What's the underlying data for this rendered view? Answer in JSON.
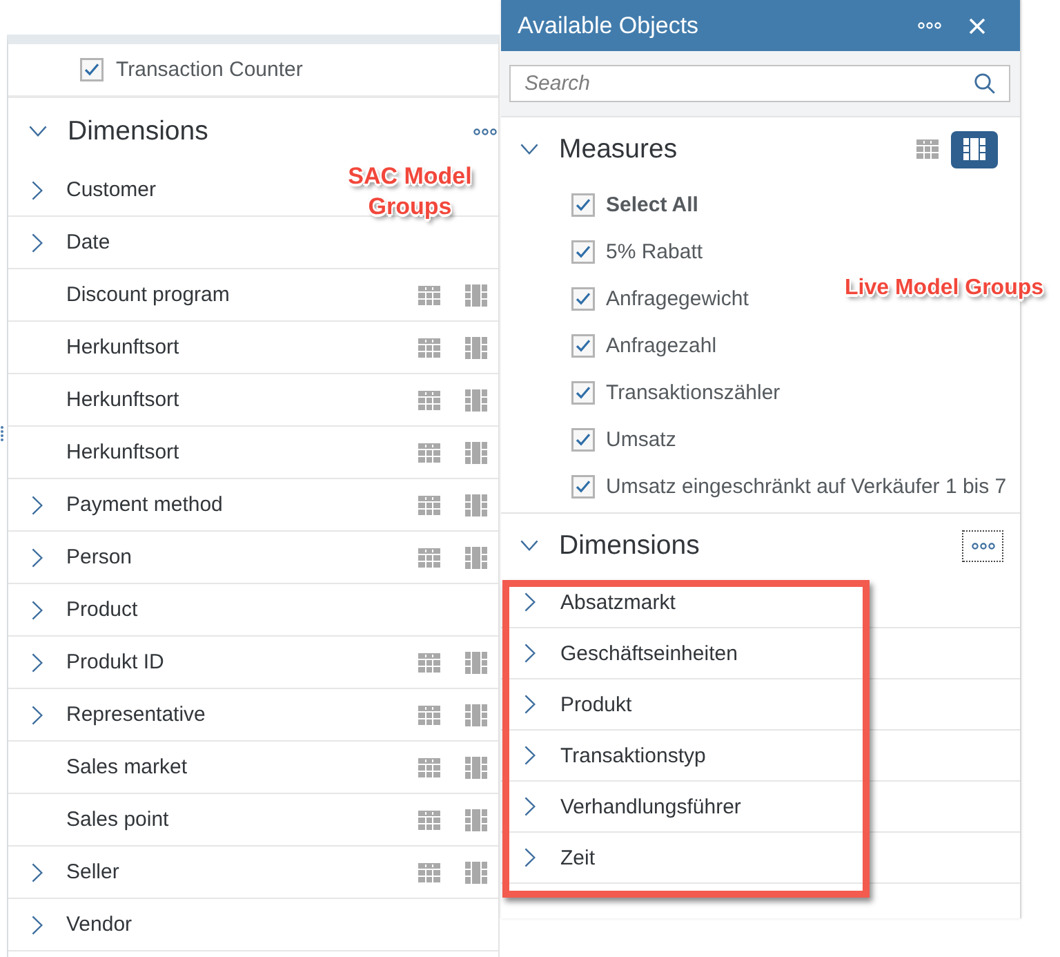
{
  "left_panel": {
    "measure": {
      "label": "Transaction Counter",
      "checked": true
    },
    "callout": "SAC Model Groups",
    "dimensions": {
      "title": "Dimensions",
      "expanded": true,
      "items": [
        {
          "label": "Customer",
          "expandable": true,
          "actions": false
        },
        {
          "label": "Date",
          "expandable": true,
          "actions": false
        },
        {
          "label": "Discount program",
          "expandable": false,
          "actions": true
        },
        {
          "label": "Herkunftsort",
          "expandable": false,
          "actions": true
        },
        {
          "label": "Herkunftsort",
          "expandable": false,
          "actions": true
        },
        {
          "label": "Herkunftsort",
          "expandable": false,
          "actions": true
        },
        {
          "label": "Payment method",
          "expandable": true,
          "actions": true
        },
        {
          "label": "Person",
          "expandable": true,
          "actions": true
        },
        {
          "label": "Product",
          "expandable": true,
          "actions": false
        },
        {
          "label": "Produkt ID",
          "expandable": true,
          "actions": true
        },
        {
          "label": "Representative",
          "expandable": true,
          "actions": true
        },
        {
          "label": "Sales market",
          "expandable": false,
          "actions": true
        },
        {
          "label": "Sales point",
          "expandable": false,
          "actions": true
        },
        {
          "label": "Seller",
          "expandable": true,
          "actions": true
        },
        {
          "label": "Vendor",
          "expandable": true,
          "actions": false
        }
      ]
    }
  },
  "right_panel": {
    "title": "Available Objects",
    "search": {
      "placeholder": "Search"
    },
    "callout": "Live Model Groups",
    "measures": {
      "title": "Measures",
      "expanded": true,
      "view_buttons": [
        {
          "kind": "table",
          "selected": false
        },
        {
          "kind": "columns",
          "selected": true
        }
      ],
      "items": [
        {
          "kind": "select_all",
          "label": "Select All",
          "checked": true
        },
        {
          "kind": "measure",
          "label": "5% Rabatt",
          "checked": true
        },
        {
          "kind": "measure",
          "label": "Anfragegewicht",
          "checked": true
        },
        {
          "kind": "measure",
          "label": "Anfragezahl",
          "checked": true
        },
        {
          "kind": "measure",
          "label": "Transaktionszähler",
          "checked": true
        },
        {
          "kind": "measure",
          "label": "Umsatz",
          "checked": true
        },
        {
          "kind": "measure",
          "label": "Umsatz eingeschränkt auf Verkäufer 1 bis 7",
          "checked": true
        }
      ]
    },
    "dimensions": {
      "title": "Dimensions",
      "expanded": true,
      "highlighted": true,
      "items": [
        {
          "label": "Absatzmarkt",
          "expandable": true
        },
        {
          "label": "Geschäftseinheiten",
          "expandable": true
        },
        {
          "label": "Produkt",
          "expandable": true
        },
        {
          "label": "Transaktionstyp",
          "expandable": true
        },
        {
          "label": "Verhandlungsführer",
          "expandable": true
        },
        {
          "label": "Zeit",
          "expandable": true
        }
      ]
    }
  }
}
